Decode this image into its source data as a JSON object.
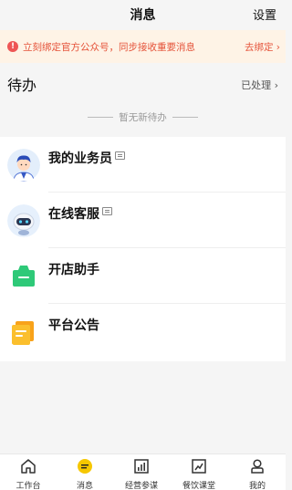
{
  "header": {
    "title": "消息",
    "settings_label": "设置"
  },
  "notice": {
    "message": "立刻绑定官方公众号，同步接收重要消息",
    "action_label": "去绑定 ›"
  },
  "todo": {
    "title": "待办",
    "handled_label": "已处理 ›",
    "empty_text": "暂无新待办"
  },
  "list": {
    "items": [
      {
        "label": "我的业务员",
        "icon": "salesman-avatar",
        "has_chat": true
      },
      {
        "label": "在线客服",
        "icon": "robot-avatar",
        "has_chat": true
      },
      {
        "label": "开店助手",
        "icon": "shop-bag-icon",
        "has_chat": false
      },
      {
        "label": "平台公告",
        "icon": "announcement-icon",
        "has_chat": false
      }
    ]
  },
  "tabbar": {
    "items": [
      {
        "label": "工作台",
        "icon": "home-icon",
        "active": false
      },
      {
        "label": "消息",
        "icon": "message-icon",
        "active": true
      },
      {
        "label": "经营参谋",
        "icon": "bar-chart-icon",
        "active": false
      },
      {
        "label": "餐饮课堂",
        "icon": "trend-chart-icon",
        "active": false
      },
      {
        "label": "我的",
        "icon": "person-icon",
        "active": false
      }
    ]
  },
  "colors": {
    "accent_yellow": "#f6c700",
    "warning": "#e5533a",
    "shop_green": "#2ec978",
    "announcement_orange": "#f8a21a"
  }
}
